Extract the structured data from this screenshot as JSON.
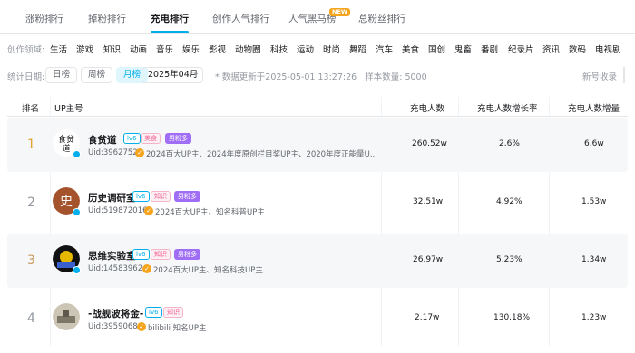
{
  "tabs": [
    {
      "label": "涨粉排行"
    },
    {
      "label": "掉粉排行"
    },
    {
      "label": "充电排行"
    },
    {
      "label": "创作人气排行"
    },
    {
      "label": "人气黑马榜",
      "badge": "NEW"
    },
    {
      "label": "总粉丝排行"
    }
  ],
  "categories": {
    "label": "创作领域:",
    "items": [
      "生活",
      "游戏",
      "知识",
      "动画",
      "音乐",
      "娱乐",
      "影视",
      "动物圈",
      "科技",
      "运动",
      "时尚",
      "舞蹈",
      "汽车",
      "美食",
      "国创",
      "鬼畜",
      "番剧",
      "纪录片",
      "资讯",
      "数码",
      "电视剧"
    ]
  },
  "filters": {
    "label": "统计日期:",
    "day": "日榜",
    "week": "周榜",
    "month": "月榜",
    "month_value": "2025年04月",
    "note": "* 数据更新于2025-05-01 13:27:26",
    "sample": "样本数量: 5000",
    "right": "新号收录"
  },
  "table": {
    "headers": [
      "排名",
      "UP主号",
      "充电人数",
      "充电人数增长率",
      "充电人数增量"
    ],
    "rows": [
      {
        "rank": "1",
        "name": "食贫道",
        "level": "lv6",
        "category": "美食",
        "gender_tag": "男粉多",
        "uid": "Uid:39627524",
        "honor": "2024百大UP主、2024年度原创栏目奖UP主、2020年度正能量U...",
        "count": "260.52w",
        "growth_rate": "2.6%",
        "increase": "6.6w"
      },
      {
        "rank": "2",
        "name": "历史调研室",
        "level": "lv6",
        "category": "知识",
        "gender_tag": "男粉多",
        "uid": "Uid:519872016",
        "honor": "2024百大UP主、知名科普UP主",
        "count": "32.51w",
        "growth_rate": "4.92%",
        "increase": "1.53w"
      },
      {
        "rank": "3",
        "name": "思维实验室",
        "level": "lv6",
        "category": "知识",
        "gender_tag": "男粉多",
        "uid": "Uid:14583962",
        "honor": "2024百大UP主、知名科技UP主",
        "count": "26.97w",
        "growth_rate": "5.23%",
        "increase": "1.34w"
      },
      {
        "rank": "4",
        "name": "-战舰波将金-",
        "level": "lv6",
        "category": "知识",
        "gender_tag": "",
        "uid": "Uid:3959068",
        "honor": "bilibili 知名UP主",
        "count": "2.17w",
        "growth_rate": "130.18%",
        "increase": "1.23w"
      }
    ]
  },
  "colors": {
    "accent": "#00aeec",
    "rank_gold": "#e2a231",
    "rank_bronze": "#c99b5c",
    "male_tag": "#a06ef5",
    "honor_icon": "#f7a41d"
  }
}
